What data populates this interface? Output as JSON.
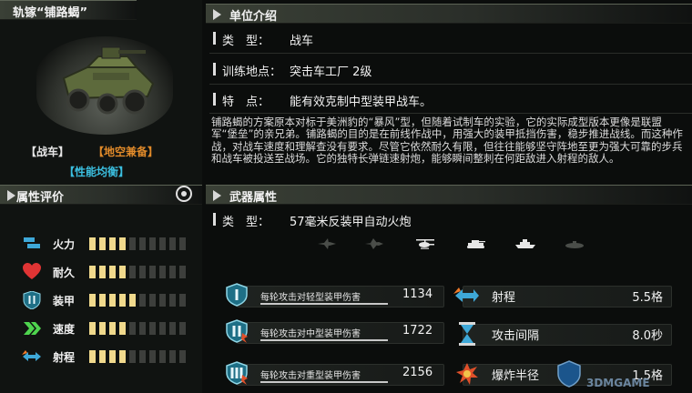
{
  "unit": {
    "name": "轨镓“铺路蝎”",
    "tags": [
      "【战车】",
      "【地空兼备】",
      "【性能均衡】"
    ],
    "tag_colors": [
      "#f0f0f0",
      "#e08a2a",
      "#3bbfe0"
    ]
  },
  "sections": {
    "unit_intro": "单位介绍",
    "attributes": "属性评价",
    "weapons": "武器属性"
  },
  "info": {
    "type_label": "类　型：",
    "type_value": "战车",
    "train_label": "训练地点：",
    "train_value": "突击车工厂 2级",
    "feature_label": "特　点：",
    "feature_value": "能有效克制中型装甲战车。"
  },
  "description": "铺路蝎的方案原本对标于美洲豹的“暴风”型，但随着试制车的实验，它的实际成型版本更像是联盟军“堡垒”的亲兄弟。铺路蝎的目的是在前线作战中，用强大的装甲抵挡伤害，稳步推进战线。而这种作战，对战车速度和理解查没有要求。尽管它依然耐久有限，但往往能够坚守阵地至更为强大可靠的步兵和战车被投送至战场。它的独特长弹链速射炮，能够瞬间整刺在何距敌进入射程的敌人。",
  "attributes": [
    {
      "label": "火力",
      "icon": "firepower-icon",
      "level": 4
    },
    {
      "label": "耐久",
      "icon": "heart-icon",
      "level": 4
    },
    {
      "label": "装甲",
      "icon": "armor-shield-icon",
      "level": 5
    },
    {
      "label": "速度",
      "icon": "speed-chevron-icon",
      "level": 4
    },
    {
      "label": "射程",
      "icon": "range-arrow-icon",
      "level": 4
    }
  ],
  "attribute_max": 10,
  "weapon": {
    "type_label": "类　型：",
    "type_value": "57毫米反装甲自动火炮",
    "targets": [
      {
        "name": "fighter-jet-target-icon",
        "active": false
      },
      {
        "name": "bomber-target-icon",
        "active": false
      },
      {
        "name": "helicopter-target-icon",
        "active": true
      },
      {
        "name": "tank-target-icon",
        "active": true
      },
      {
        "name": "ship-target-icon",
        "active": true
      },
      {
        "name": "submarine-target-icon",
        "active": false
      }
    ],
    "damage": [
      {
        "label": "每轮攻击对轻型装甲伤害",
        "value": "1134",
        "icon": "light-armor-icon"
      },
      {
        "label": "每轮攻击对中型装甲伤害",
        "value": "1722",
        "icon": "medium-armor-icon"
      },
      {
        "label": "每轮攻击对重型装甲伤害",
        "value": "2156",
        "icon": "heavy-armor-icon"
      }
    ],
    "stats": [
      {
        "label": "射程",
        "value": "5.5格",
        "icon": "range-icon"
      },
      {
        "label": "攻击间隔",
        "value": "8.0秒",
        "icon": "hourglass-icon"
      },
      {
        "label": "爆炸半径",
        "value": "1.5格",
        "icon": "explosion-icon"
      }
    ]
  },
  "watermark": "3DMGAME"
}
